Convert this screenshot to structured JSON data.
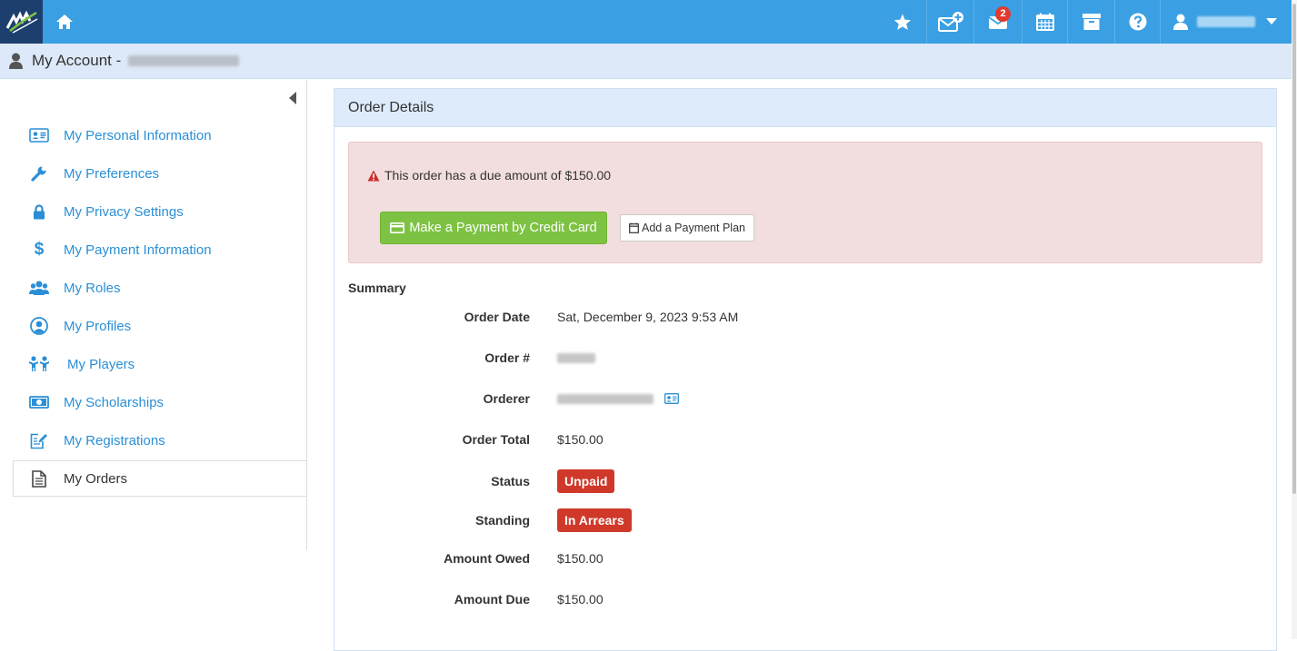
{
  "topbar": {
    "badge_count": "2",
    "icons": [
      "logo-icon",
      "home-icon",
      "star-icon",
      "compose-mail-icon",
      "inbox-icon",
      "calendar-icon",
      "archive-icon",
      "help-icon",
      "user-icon",
      "caret-down-icon"
    ]
  },
  "account": {
    "title": "My Account -"
  },
  "sidebar": {
    "items": [
      {
        "label": "My Personal Information"
      },
      {
        "label": "My Preferences"
      },
      {
        "label": "My Privacy Settings"
      },
      {
        "label": "My Payment Information"
      },
      {
        "label": "My Roles"
      },
      {
        "label": "My Profiles"
      },
      {
        "label": "My Players"
      },
      {
        "label": "My Scholarships"
      },
      {
        "label": "My Registrations"
      },
      {
        "label": "My Orders"
      }
    ]
  },
  "panel": {
    "title": "Order Details",
    "alert_text": "This order has a due amount of $150.00",
    "pay_button": "Make a Payment by Credit Card",
    "plan_button": "Add a Payment Plan"
  },
  "summary": {
    "title": "Summary",
    "order_date_label": "Order Date",
    "order_date": "Sat, December 9, 2023 9:53 AM",
    "order_num_label": "Order #",
    "orderer_label": "Orderer",
    "order_total_label": "Order Total",
    "order_total": "$150.00",
    "status_label": "Status",
    "status": "Unpaid",
    "standing_label": "Standing",
    "standing": "In Arrears",
    "amount_owed_label": "Amount Owed",
    "amount_owed": "$150.00",
    "amount_due_label": "Amount Due",
    "amount_due": "$150.00"
  },
  "colors": {
    "topbar": "#3aa0e3",
    "link": "#2a8fd6",
    "danger": "#d0382a",
    "success": "#7dc242"
  }
}
